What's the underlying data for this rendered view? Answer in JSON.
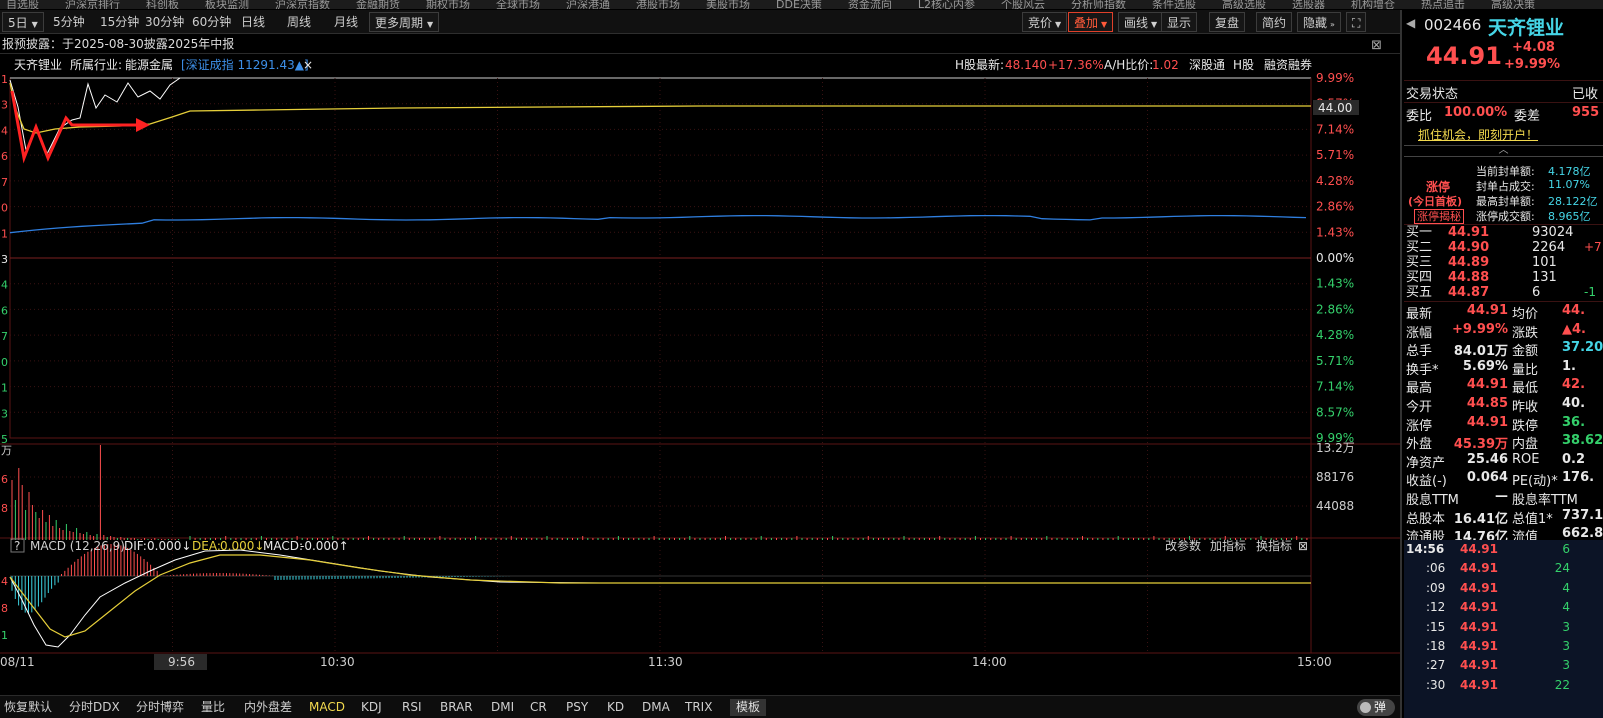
{
  "topnav": [
    "自选股",
    "沪深京排行",
    "科创板",
    "板块监测",
    "沪深京指数",
    "金融期货",
    "期权市场",
    "全球市场",
    "沪深港通",
    "港股市场",
    "美股市场",
    "DDE决策",
    "资金流向",
    "L2核心内参",
    "个股风云",
    "分析师指数",
    "条件选股",
    "高级选股",
    "选股器",
    "机构增仓",
    "热点追击",
    "高级决策"
  ],
  "toolbar": {
    "periods": [
      "5日",
      "5分钟",
      "15分钟",
      "30分钟",
      "60分钟",
      "日线",
      "周线",
      "月线",
      "更多周期"
    ],
    "right_buttons": [
      "竞价",
      "叠加",
      "画线",
      "显示",
      "复盘",
      "简约",
      "隐藏"
    ],
    "active_right": "叠加"
  },
  "notice": {
    "text": "报预披露：于2025-08-30披露2025年中报"
  },
  "info": {
    "stock_name": "天齐锂业",
    "industry_label": "所属行业:",
    "industry": "能源金属",
    "overlay_index": "[深证成指 11291.43▲]",
    "overlay_close": "×",
    "h_latest_label": "H股最新:",
    "h_latest": "48.140",
    "h_change": "+17.36%",
    "ah_label": "A/H比价:",
    "ah_value": "1.02",
    "badges": [
      "深股通",
      "H股",
      "融资融券"
    ]
  },
  "price_axis": [
    "9.99%",
    "8.57%",
    "7.14%",
    "5.71%",
    "4.28%",
    "2.86%",
    "1.43%",
    "0.00%",
    "1.43%",
    "2.86%",
    "4.28%",
    "5.71%",
    "7.14%",
    "8.57%",
    "9.99%"
  ],
  "left_ticks": [
    "1",
    "3",
    "4",
    "6",
    "7",
    "0",
    "1",
    "3",
    "4",
    "6",
    "7",
    "0",
    "1",
    "3",
    "5"
  ],
  "price_tag": "44.00",
  "volume_axis": [
    "13.2万",
    "88176",
    "44088"
  ],
  "volume_left": [
    "万",
    "6",
    "8"
  ],
  "macd": {
    "title": "MACD (12,26,9)",
    "dif_label": "DIF:",
    "dif": "0.000↓",
    "dea_label": "DEA:",
    "dea": "0.000↓",
    "macd_label": "MACD:",
    "macd": "-0.000↑",
    "actions": [
      "改参数",
      "加指标",
      "换指标"
    ],
    "left_ticks": [
      "4",
      "8",
      "1"
    ]
  },
  "time_axis": {
    "date": "08/11",
    "labels": [
      "9:56",
      "10:30",
      "11:30",
      "14:00",
      "15:00"
    ],
    "cursor": "9:56"
  },
  "bottom_tabs": [
    "恢复默认",
    "分时DDX",
    "分时博弈",
    "量比",
    "内外盘差",
    "MACD",
    "KDJ",
    "RSI",
    "BRAR",
    "DMI",
    "CR",
    "PSY",
    "KD",
    "DMA",
    "TRIX",
    "模板"
  ],
  "active_tab": "MACD",
  "toggle_label": "弹",
  "quote": {
    "code": "002466",
    "name": "天齐锂业",
    "price": "44.91",
    "change": "+4.08",
    "change_pct": "+9.99%",
    "status_label": "交易状态",
    "status": "已收",
    "wb_label": "委比",
    "wb_value": "100.00%",
    "wc_label": "委差",
    "wc_value": "955",
    "promo": "抓住机会，即刻开户！",
    "limit_title": "涨停",
    "limit_sub": "(今日首板)",
    "limit_btn": "涨停揭秘",
    "limit_stats": [
      {
        "label": "当前封单额:",
        "value": "4.178亿"
      },
      {
        "label": "封单占成交:",
        "value": "11.07%"
      },
      {
        "label": "最高封单额:",
        "value": "28.122亿"
      },
      {
        "label": "涨停成交额:",
        "value": "8.965亿"
      }
    ],
    "bids": [
      {
        "label": "买一",
        "price": "44.91",
        "vol": "93024",
        "diff": ""
      },
      {
        "label": "买二",
        "price": "44.90",
        "vol": "2264",
        "diff": "+7"
      },
      {
        "label": "买三",
        "price": "44.89",
        "vol": "101",
        "diff": ""
      },
      {
        "label": "买四",
        "price": "44.88",
        "vol": "131",
        "diff": ""
      },
      {
        "label": "买五",
        "price": "44.87",
        "vol": "6",
        "diff": "-1"
      }
    ],
    "stats": [
      {
        "l1": "最新",
        "v1": "44.91",
        "c1": "red",
        "l2": "均价",
        "v2": "44.",
        "c2": "red"
      },
      {
        "l1": "涨幅",
        "v1": "+9.99%",
        "c1": "red",
        "l2": "涨跌",
        "v2": "▲4.",
        "c2": "red"
      },
      {
        "l1": "总手",
        "v1": "84.01万",
        "c1": "white",
        "l2": "金额",
        "v2": "37.20",
        "c2": "cyan"
      },
      {
        "l1": "换手*",
        "v1": "5.69%",
        "c1": "white",
        "l2": "量比",
        "v2": "1.",
        "c2": "white"
      },
      {
        "l1": "最高",
        "v1": "44.91",
        "c1": "red",
        "l2": "最低",
        "v2": "42.",
        "c2": "red"
      },
      {
        "l1": "今开",
        "v1": "44.85",
        "c1": "red",
        "l2": "昨收",
        "v2": "40.",
        "c2": "white"
      },
      {
        "l1": "涨停",
        "v1": "44.91",
        "c1": "red",
        "l2": "跌停",
        "v2": "36.",
        "c2": "green"
      },
      {
        "l1": "外盘",
        "v1": "45.39万",
        "c1": "red",
        "l2": "内盘",
        "v2": "38.62",
        "c2": "green"
      },
      {
        "l1": "净资产",
        "v1": "25.46",
        "c1": "white",
        "l2": "ROE",
        "v2": "0.2",
        "c2": "white"
      },
      {
        "l1": "收益(-)",
        "v1": "0.064",
        "c1": "white",
        "l2": "PE(动)*",
        "v2": "176.",
        "c2": "white"
      },
      {
        "l1": "股息TTM",
        "v1": "—",
        "c1": "white",
        "l2": "股息率TTM",
        "v2": "",
        "c2": "white"
      },
      {
        "l1": "总股本",
        "v1": "16.41亿",
        "c1": "white",
        "l2": "总值1*",
        "v2": "737.1",
        "c2": "white"
      },
      {
        "l1": "流通股",
        "v1": "14.76亿",
        "c1": "white",
        "l2": "流值",
        "v2": "662.8",
        "c2": "white"
      }
    ],
    "ticks": [
      {
        "time": "14:56",
        "price": "44.91",
        "vol": "6"
      },
      {
        "time": ":06",
        "price": "44.91",
        "vol": "24"
      },
      {
        "time": ":09",
        "price": "44.91",
        "vol": "4"
      },
      {
        "time": ":12",
        "price": "44.91",
        "vol": "4"
      },
      {
        "time": ":15",
        "price": "44.91",
        "vol": "3"
      },
      {
        "time": ":18",
        "price": "44.91",
        "vol": "3"
      },
      {
        "time": ":27",
        "price": "44.91",
        "vol": "3"
      },
      {
        "time": ":30",
        "price": "44.91",
        "vol": "22"
      }
    ]
  },
  "colors": {
    "up": "#ff4f4f",
    "down": "#34d06b",
    "price_line": "#ffffff",
    "avg_line": "#e6cf3a",
    "index_line": "#2f7fe0",
    "arrow": "#ff2222"
  }
}
